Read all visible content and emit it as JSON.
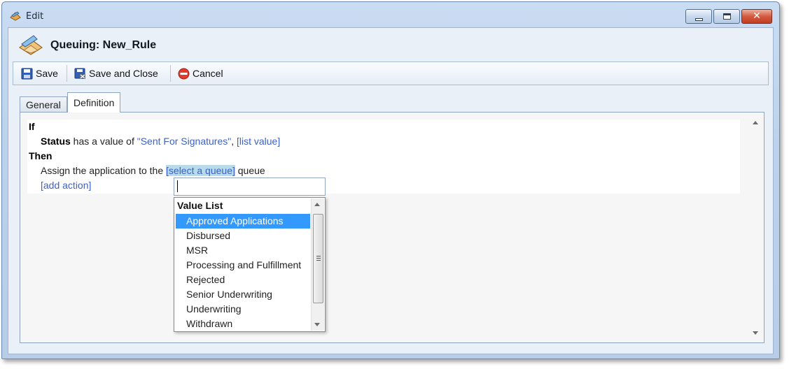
{
  "window": {
    "title": "Edit",
    "page_title": "Queuing: New_Rule",
    "close_glyph": "✕"
  },
  "toolbar": {
    "save_label": "Save",
    "save_close_label": "Save and Close",
    "cancel_label": "Cancel"
  },
  "tabs": [
    {
      "label": "General",
      "active": false
    },
    {
      "label": "Definition",
      "active": true
    }
  ],
  "rule": {
    "if_keyword": "If",
    "condition_field": "Status",
    "condition_text": " has a value of ",
    "condition_value": "\"Sent For Signatures\"",
    "condition_sep": ", ",
    "list_value_link": "[list value]",
    "then_keyword": "Then",
    "action_prefix": "Assign the application to the ",
    "queue_link": "[select a queue]",
    "action_suffix": " queue",
    "add_action_link": "[add action]"
  },
  "queue_editor": {
    "input_value": ""
  },
  "dropdown": {
    "header": "Value List",
    "selected_index": 0,
    "items": [
      "Approved Applications",
      "Disbursed",
      "MSR",
      "Processing and Fulfillment",
      "Rejected",
      "Senior Underwriting",
      "Underwriting",
      "Withdrawn"
    ]
  },
  "colors": {
    "link": "#3d62c8",
    "selection": "#3399ff",
    "highlight": "#b7dbe8",
    "window_frame": "#bcd2ec"
  },
  "icons": {
    "title": "edit-app-icon",
    "header": "queuing-rule-icon",
    "save": "floppy-disk-icon",
    "save_close": "floppy-disk-close-icon",
    "cancel": "stop-sign-icon"
  }
}
